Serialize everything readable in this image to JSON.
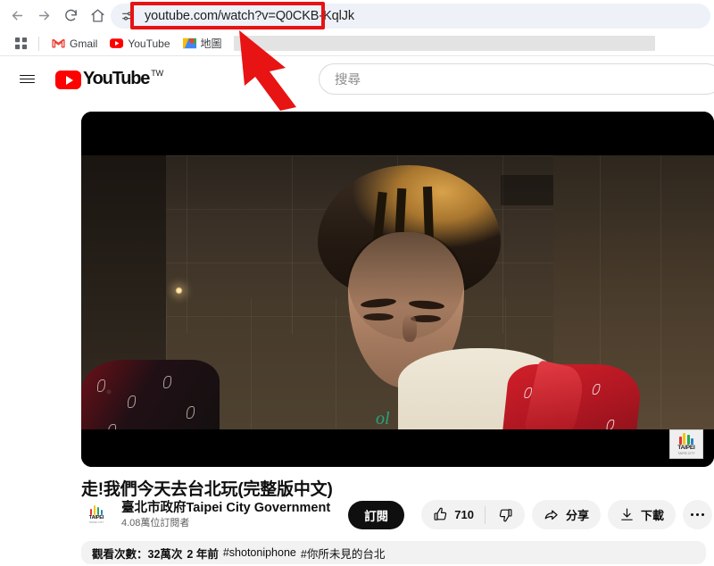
{
  "browser": {
    "nav": {
      "back": "back-arrow",
      "forward": "forward-arrow",
      "reload": "reload",
      "home": "home"
    },
    "omnibox": {
      "url": "youtube.com/watch?v=Q0CKB-KqlJk",
      "site_settings_icon": "tune-icon"
    },
    "bookmarks": {
      "apps_label": "apps-grid",
      "items": [
        {
          "label": "Gmail",
          "icon": "gmail-icon"
        },
        {
          "label": "YouTube",
          "icon": "youtube-icon"
        },
        {
          "label": "地圖",
          "icon": "maps-icon"
        }
      ]
    }
  },
  "annotation": {
    "highlight_color": "#e81313",
    "arrow_color": "#e81313",
    "target": "omnibox-url"
  },
  "youtube": {
    "header": {
      "menu_label": "guide-menu",
      "logo_text": "YouTube",
      "country_code": "TW",
      "search_placeholder": "搜尋"
    },
    "player": {
      "watermark": {
        "text": "TAIPEI",
        "sub": "TAIPEI CITY"
      },
      "overlay_text": "ol"
    },
    "video": {
      "title": "走!我們今天去台北玩(完整版中文)",
      "channel_name": "臺北市政府Taipei City Government",
      "subscriber_count": "4.08萬位訂閱者",
      "subscribe_label": "訂閱",
      "avatar": {
        "text": "TAIPEI",
        "sub": "TAIPEI CITY"
      },
      "actions": {
        "like_count": "710",
        "like_icon": "thumbs-up-icon",
        "dislike_icon": "thumbs-down-icon",
        "share_label": "分享",
        "share_icon": "share-icon",
        "download_label": "下載",
        "download_icon": "download-icon",
        "more_label": "more-options"
      },
      "meta": {
        "views": "觀看次數：32萬次",
        "published": "2 年前",
        "hashtags": [
          "#shotoniphone",
          "#你所未見的台北"
        ]
      }
    }
  }
}
